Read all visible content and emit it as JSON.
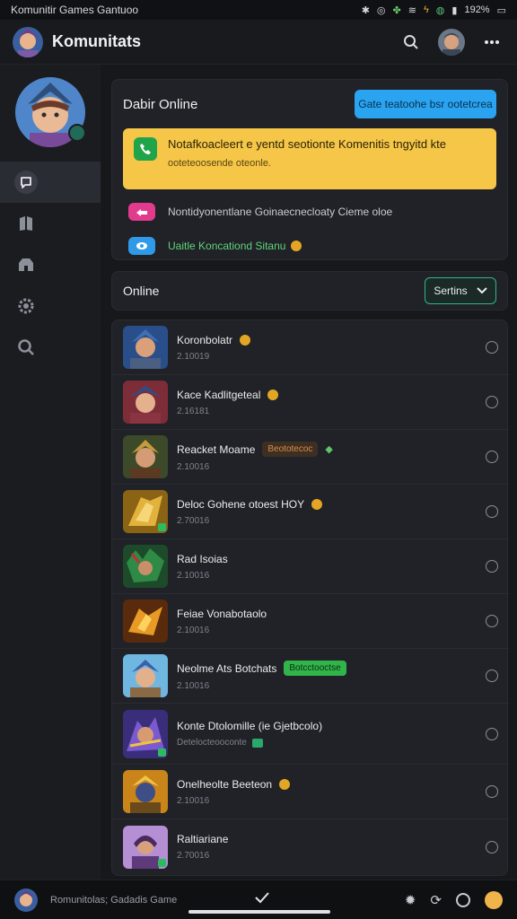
{
  "status_bar": {
    "title": "Komunitir Games Gantuoo",
    "battery": "192%"
  },
  "app_bar": {
    "title": "Komunitats"
  },
  "status_card": {
    "heading": "Dabir Online",
    "action_label": "Gate teatoohe bsr ootetcrea",
    "notice_line1": "Notafkoacleert e yentd seotionte Komenitis tngyitd kte",
    "notice_line2": "ooteteoosende oteonle.",
    "info_rows": [
      {
        "text": "Nontidyonentlane Goinaecnecloaty Cieme oloe"
      },
      {
        "text": "Uaitle Koncationd Sitanu"
      }
    ]
  },
  "online_section": {
    "heading": "Online",
    "sort_label": "Sertins"
  },
  "players": [
    {
      "name": "Koronbolatr",
      "sub": "2.10019",
      "coin": true,
      "tag": "",
      "tag_style": ""
    },
    {
      "name": "Kace Kadlitgeteal",
      "sub": "2.16181",
      "coin": true,
      "tag": "",
      "tag_style": ""
    },
    {
      "name": "Reacket Moame",
      "sub": "2.10016",
      "coin": false,
      "tag": "Beototecoc",
      "tag_style": "brown"
    },
    {
      "name": "Deloc Gohene otoest HOY",
      "sub": "2.70016",
      "coin": true,
      "tag": "",
      "tag_style": ""
    },
    {
      "name": "Rad Isoias",
      "sub": "2.10016",
      "coin": false,
      "tag": "",
      "tag_style": ""
    },
    {
      "name": "Feiae Vonabotaolo",
      "sub": "2.10016",
      "coin": false,
      "tag": "",
      "tag_style": ""
    },
    {
      "name": "Neolme Ats Botchats",
      "sub": "2.10016",
      "coin": false,
      "tag": "Botcctooctse",
      "tag_style": "green"
    },
    {
      "name": "Konte Dtolomille (ie Gjetbcolo)",
      "sub": "Detelocteooconte",
      "coin": false,
      "tag": "",
      "tag_style": ""
    },
    {
      "name": "Onelheolte Beeteon",
      "sub": "2.10016",
      "coin": true,
      "tag": "",
      "tag_style": ""
    },
    {
      "name": "Raltiariane",
      "sub": "2.70016",
      "coin": false,
      "tag": "",
      "tag_style": ""
    }
  ],
  "bottom_bar": {
    "title": "Romunitolas; Gadadis Game"
  },
  "icons": {
    "search": "search-icon",
    "more": "more-icon",
    "chat": "chat-icon",
    "chevron": "chevron-down-icon"
  },
  "colors": {
    "accent_blue": "#2aa3f0",
    "notice_yellow": "#f5c647",
    "online_green": "#2fb58a"
  }
}
